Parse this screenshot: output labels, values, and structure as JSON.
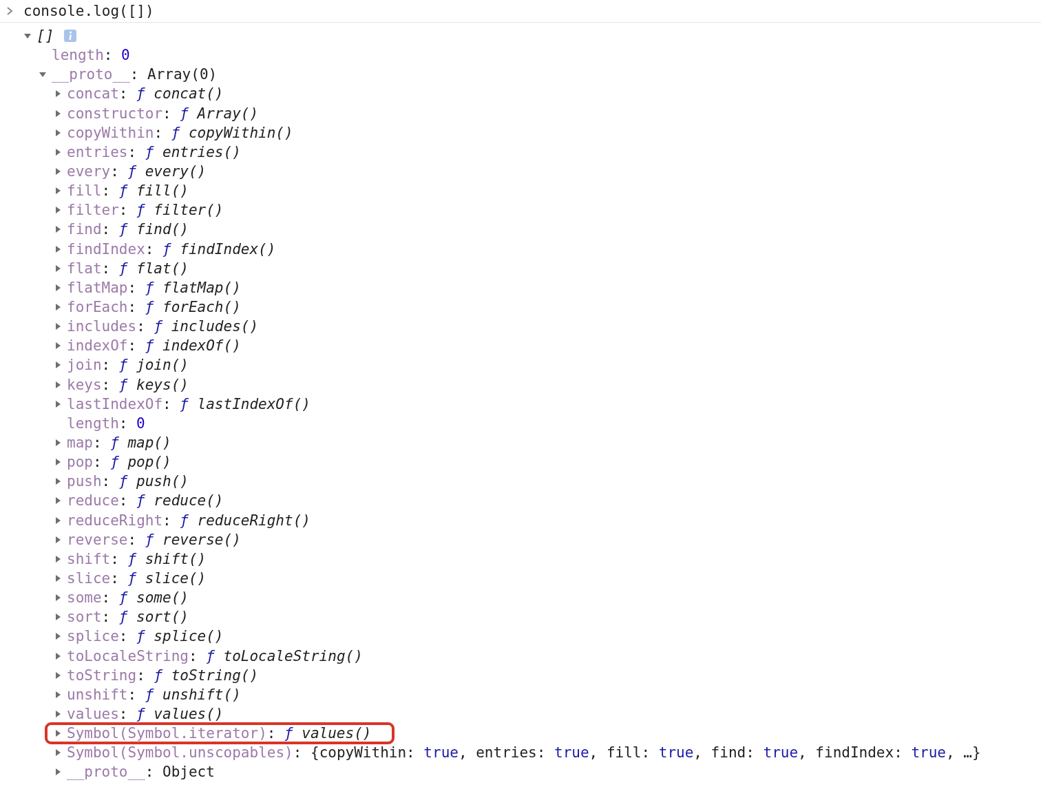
{
  "prompt": {
    "command": "console.log([])"
  },
  "tree": {
    "label": "[]",
    "info": true,
    "expanded": true,
    "children": [
      {
        "key": "length",
        "sep": ":",
        "kind": "number",
        "value": "0"
      },
      {
        "key": "__proto__",
        "sep": ":",
        "kind": "text",
        "value": "Array(0)",
        "expanded": true,
        "children": [
          {
            "key": "concat",
            "sep": ":",
            "kind": "function",
            "mark": "ƒ",
            "value": "concat()",
            "expanded": false,
            "highlighted": false
          },
          {
            "key": "constructor",
            "sep": ":",
            "kind": "function",
            "mark": "ƒ",
            "value": "Array()",
            "expanded": false,
            "highlighted": false
          },
          {
            "key": "copyWithin",
            "sep": ":",
            "kind": "function",
            "mark": "ƒ",
            "value": "copyWithin()",
            "expanded": false,
            "highlighted": false
          },
          {
            "key": "entries",
            "sep": ":",
            "kind": "function",
            "mark": "ƒ",
            "value": "entries()",
            "expanded": false,
            "highlighted": false
          },
          {
            "key": "every",
            "sep": ":",
            "kind": "function",
            "mark": "ƒ",
            "value": "every()",
            "expanded": false,
            "highlighted": false
          },
          {
            "key": "fill",
            "sep": ":",
            "kind": "function",
            "mark": "ƒ",
            "value": "fill()",
            "expanded": false,
            "highlighted": false
          },
          {
            "key": "filter",
            "sep": ":",
            "kind": "function",
            "mark": "ƒ",
            "value": "filter()",
            "expanded": false,
            "highlighted": false
          },
          {
            "key": "find",
            "sep": ":",
            "kind": "function",
            "mark": "ƒ",
            "value": "find()",
            "expanded": false,
            "highlighted": false
          },
          {
            "key": "findIndex",
            "sep": ":",
            "kind": "function",
            "mark": "ƒ",
            "value": "findIndex()",
            "expanded": false,
            "highlighted": false
          },
          {
            "key": "flat",
            "sep": ":",
            "kind": "function",
            "mark": "ƒ",
            "value": "flat()",
            "expanded": false,
            "highlighted": false
          },
          {
            "key": "flatMap",
            "sep": ":",
            "kind": "function",
            "mark": "ƒ",
            "value": "flatMap()",
            "expanded": false,
            "highlighted": false
          },
          {
            "key": "forEach",
            "sep": ":",
            "kind": "function",
            "mark": "ƒ",
            "value": "forEach()",
            "expanded": false,
            "highlighted": false
          },
          {
            "key": "includes",
            "sep": ":",
            "kind": "function",
            "mark": "ƒ",
            "value": "includes()",
            "expanded": false,
            "highlighted": false
          },
          {
            "key": "indexOf",
            "sep": ":",
            "kind": "function",
            "mark": "ƒ",
            "value": "indexOf()",
            "expanded": false,
            "highlighted": false
          },
          {
            "key": "join",
            "sep": ":",
            "kind": "function",
            "mark": "ƒ",
            "value": "join()",
            "expanded": false,
            "highlighted": false
          },
          {
            "key": "keys",
            "sep": ":",
            "kind": "function",
            "mark": "ƒ",
            "value": "keys()",
            "expanded": false,
            "highlighted": false
          },
          {
            "key": "lastIndexOf",
            "sep": ":",
            "kind": "function",
            "mark": "ƒ",
            "value": "lastIndexOf()",
            "expanded": false,
            "highlighted": false
          },
          {
            "key": "length",
            "sep": ":",
            "kind": "number",
            "value": "0",
            "highlighted": false
          },
          {
            "key": "map",
            "sep": ":",
            "kind": "function",
            "mark": "ƒ",
            "value": "map()",
            "expanded": false,
            "highlighted": false
          },
          {
            "key": "pop",
            "sep": ":",
            "kind": "function",
            "mark": "ƒ",
            "value": "pop()",
            "expanded": false,
            "highlighted": false
          },
          {
            "key": "push",
            "sep": ":",
            "kind": "function",
            "mark": "ƒ",
            "value": "push()",
            "expanded": false,
            "highlighted": false
          },
          {
            "key": "reduce",
            "sep": ":",
            "kind": "function",
            "mark": "ƒ",
            "value": "reduce()",
            "expanded": false,
            "highlighted": false
          },
          {
            "key": "reduceRight",
            "sep": ":",
            "kind": "function",
            "mark": "ƒ",
            "value": "reduceRight()",
            "expanded": false,
            "highlighted": false
          },
          {
            "key": "reverse",
            "sep": ":",
            "kind": "function",
            "mark": "ƒ",
            "value": "reverse()",
            "expanded": false,
            "highlighted": false
          },
          {
            "key": "shift",
            "sep": ":",
            "kind": "function",
            "mark": "ƒ",
            "value": "shift()",
            "expanded": false,
            "highlighted": false
          },
          {
            "key": "slice",
            "sep": ":",
            "kind": "function",
            "mark": "ƒ",
            "value": "slice()",
            "expanded": false,
            "highlighted": false
          },
          {
            "key": "some",
            "sep": ":",
            "kind": "function",
            "mark": "ƒ",
            "value": "some()",
            "expanded": false,
            "highlighted": false
          },
          {
            "key": "sort",
            "sep": ":",
            "kind": "function",
            "mark": "ƒ",
            "value": "sort()",
            "expanded": false,
            "highlighted": false
          },
          {
            "key": "splice",
            "sep": ":",
            "kind": "function",
            "mark": "ƒ",
            "value": "splice()",
            "expanded": false,
            "highlighted": false
          },
          {
            "key": "toLocaleString",
            "sep": ":",
            "kind": "function",
            "mark": "ƒ",
            "value": "toLocaleString()",
            "expanded": false,
            "highlighted": false
          },
          {
            "key": "toString",
            "sep": ":",
            "kind": "function",
            "mark": "ƒ",
            "value": "toString()",
            "expanded": false,
            "highlighted": false
          },
          {
            "key": "unshift",
            "sep": ":",
            "kind": "function",
            "mark": "ƒ",
            "value": "unshift()",
            "expanded": false,
            "highlighted": false
          },
          {
            "key": "values",
            "sep": ":",
            "kind": "function",
            "mark": "ƒ",
            "value": "values()",
            "expanded": false,
            "highlighted": false
          },
          {
            "key": "Symbol(Symbol.iterator)",
            "sep": ":",
            "kind": "function",
            "mark": "ƒ",
            "value": "values()",
            "expanded": false,
            "highlighted": true
          },
          {
            "key": "Symbol(Symbol.unscopables)",
            "sep": ":",
            "kind": "preview",
            "segments": [
              {
                "kind": "plain",
                "text": "{copyWithin: "
              },
              {
                "kind": "bool",
                "text": "true"
              },
              {
                "kind": "plain",
                "text": ", entries: "
              },
              {
                "kind": "bool",
                "text": "true"
              },
              {
                "kind": "plain",
                "text": ", fill: "
              },
              {
                "kind": "bool",
                "text": "true"
              },
              {
                "kind": "plain",
                "text": ", find: "
              },
              {
                "kind": "bool",
                "text": "true"
              },
              {
                "kind": "plain",
                "text": ", findIndex: "
              },
              {
                "kind": "bool",
                "text": "true"
              },
              {
                "kind": "plain",
                "text": ", …}"
              }
            ],
            "expanded": false,
            "highlighted": false
          },
          {
            "key": "__proto__",
            "sep": ":",
            "kind": "text",
            "value": "Object",
            "expanded": false,
            "highlighted": false
          }
        ]
      }
    ]
  }
}
